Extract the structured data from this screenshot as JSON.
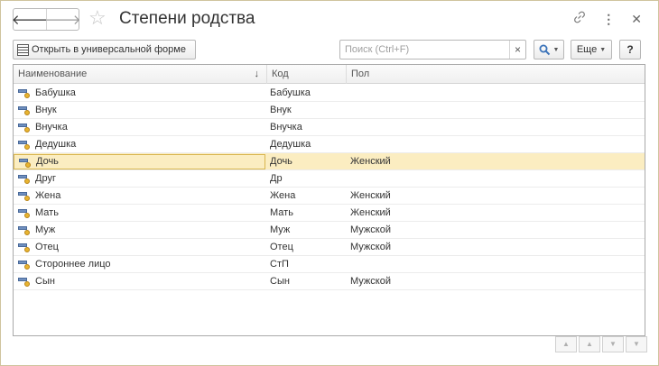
{
  "window": {
    "title": "Степени родства"
  },
  "nav": {
    "back_icon": "arrow-left-icon",
    "forward_icon": "arrow-right-icon",
    "favorite_icon": "star-icon"
  },
  "title_actions": {
    "link_icon": "link-icon",
    "menu_icon": "more-vertical-icon",
    "close_icon": "close-icon"
  },
  "toolbar": {
    "open_form_label": "Открыть в универсальной форме",
    "search_placeholder": "Поиск (Ctrl+F)",
    "search_clear": "×",
    "more_label": "Еще",
    "help_label": "?"
  },
  "table": {
    "columns": [
      "Наименование",
      "Код",
      "Пол"
    ],
    "sort_indicator": "↓",
    "selected_index": 4,
    "rows": [
      {
        "name": "Бабушка",
        "code": "Бабушка",
        "gender": ""
      },
      {
        "name": "Внук",
        "code": "Внук",
        "gender": ""
      },
      {
        "name": "Внучка",
        "code": "Внучка",
        "gender": ""
      },
      {
        "name": "Дедушка",
        "code": "Дедушка",
        "gender": ""
      },
      {
        "name": "Дочь",
        "code": "Дочь",
        "gender": "Женский"
      },
      {
        "name": "Друг",
        "code": "Др",
        "gender": ""
      },
      {
        "name": "Жена",
        "code": "Жена",
        "gender": "Женский"
      },
      {
        "name": "Мать",
        "code": "Мать",
        "gender": "Женский"
      },
      {
        "name": "Муж",
        "code": "Муж",
        "gender": "Мужской"
      },
      {
        "name": "Отец",
        "code": "Отец",
        "gender": "Мужской"
      },
      {
        "name": "Стороннее лицо",
        "code": "СтП",
        "gender": ""
      },
      {
        "name": "Сын",
        "code": "Сын",
        "gender": "Мужской"
      }
    ]
  },
  "colors": {
    "selected_row": "#fbedc1",
    "selected_border": "#d8b54e",
    "accent": "#3b73b9"
  }
}
